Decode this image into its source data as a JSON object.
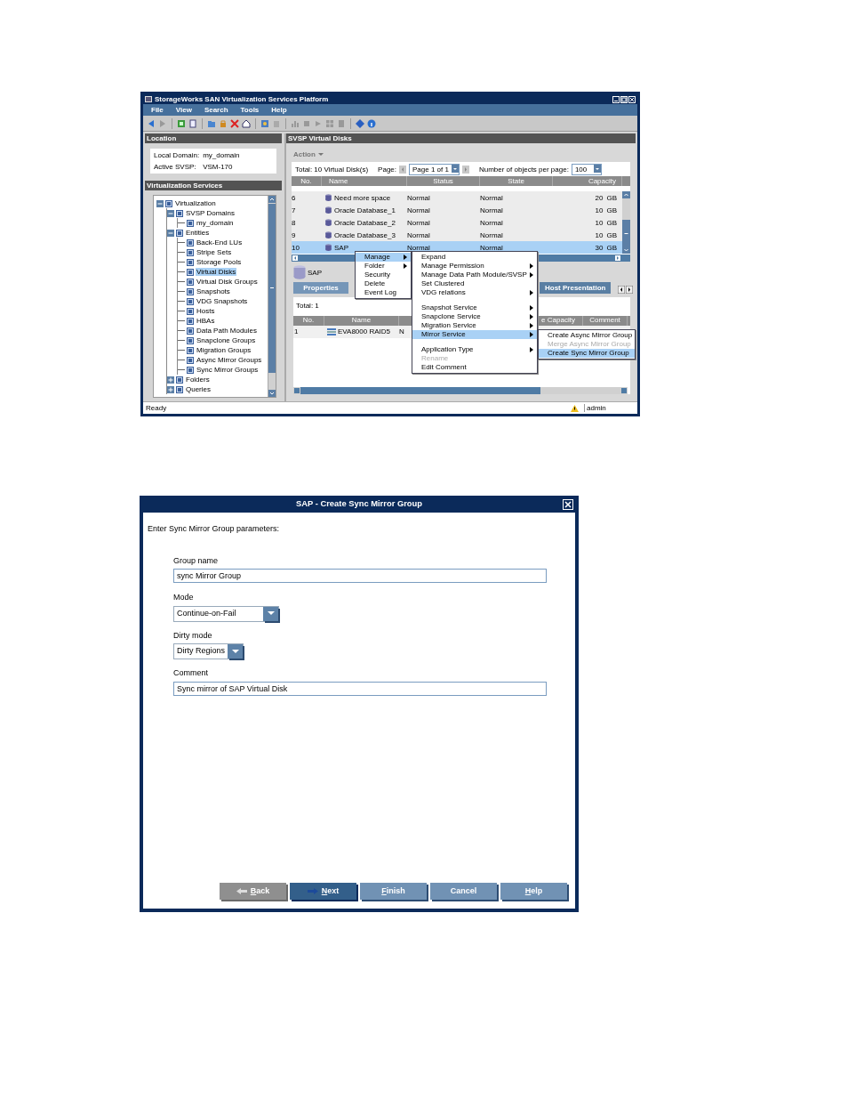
{
  "app": {
    "title": "StorageWorks SAN Virtualization Services Platform",
    "menu": [
      "File",
      "View",
      "Search",
      "Tools",
      "Help"
    ],
    "location": {
      "title": "Location",
      "fields": [
        {
          "label": "Local Domain:",
          "value": "my_domain"
        },
        {
          "label": "Active SVSP:",
          "value": "VSM-170"
        }
      ]
    },
    "tree": {
      "title": "Virtualization Services",
      "items": [
        {
          "label": "Virtualization",
          "expanded": true,
          "selected": false,
          "children": [
            {
              "label": "SVSP Domains",
              "expanded": true,
              "selected": false,
              "children": [
                {
                  "label": "my_domain",
                  "selected": false
                }
              ]
            },
            {
              "label": "Entities",
              "expanded": true,
              "selected": false,
              "children": [
                {
                  "label": "Back-End LUs",
                  "selected": false
                },
                {
                  "label": "Stripe Sets",
                  "selected": false
                },
                {
                  "label": "Storage Pools",
                  "selected": false
                },
                {
                  "label": "Virtual Disks",
                  "selected": true
                },
                {
                  "label": "Virtual Disk Groups",
                  "selected": false
                },
                {
                  "label": "Snapshots",
                  "selected": false
                },
                {
                  "label": "VDG Snapshots",
                  "selected": false
                },
                {
                  "label": "Hosts",
                  "selected": false
                },
                {
                  "label": "HBAs",
                  "selected": false
                },
                {
                  "label": "Data Path Modules",
                  "selected": false
                },
                {
                  "label": "Snapclone Groups",
                  "selected": false
                },
                {
                  "label": "Migration Groups",
                  "selected": false
                },
                {
                  "label": "Async Mirror Groups",
                  "selected": false
                },
                {
                  "label": "Sync Mirror Groups",
                  "selected": false
                }
              ]
            },
            {
              "label": "Folders",
              "expanded": false,
              "selected": false
            },
            {
              "label": "Queries",
              "expanded": false,
              "selected": false
            }
          ]
        }
      ]
    },
    "panel": {
      "title": "SVSP Virtual Disks",
      "action": "Action",
      "total": "Total: 10 Virtual Disk(s)",
      "page_label": "Page:",
      "page": "Page 1 of 1",
      "per_page_label": "Number of objects per page:",
      "per_page": "100",
      "columns": [
        "No.",
        "Name",
        "Status",
        "State",
        "Capacity"
      ],
      "rows": [
        {
          "no": "6",
          "name": "Need more space",
          "status": "Normal",
          "state": "Normal",
          "capacity": "20",
          "unit": "GB",
          "selected": false
        },
        {
          "no": "7",
          "name": "Oracle Database_1",
          "status": "Normal",
          "state": "Normal",
          "capacity": "10",
          "unit": "GB",
          "selected": false
        },
        {
          "no": "8",
          "name": "Oracle Database_2",
          "status": "Normal",
          "state": "Normal",
          "capacity": "10",
          "unit": "GB",
          "selected": false
        },
        {
          "no": "9",
          "name": "Oracle Database_3",
          "status": "Normal",
          "state": "Normal",
          "capacity": "10",
          "unit": "GB",
          "selected": false
        },
        {
          "no": "10",
          "name": "SAP",
          "status": "Normal",
          "state": "Normal",
          "capacity": "30",
          "unit": "GB",
          "selected": true
        }
      ]
    },
    "detail": {
      "name": "SAP",
      "tabs": [
        {
          "label": "Properties",
          "selected": true
        },
        {
          "label": "Host Presentation",
          "selected": false
        }
      ],
      "total": "Total: 1",
      "columns": [
        "No.",
        "Name",
        "e Capacity",
        "Comment"
      ],
      "rows": [
        {
          "no": "1",
          "name": "EVA8000 RAID5",
          "column_3": "N"
        }
      ]
    },
    "context_menu": {
      "items": [
        {
          "label": "Manage",
          "submenu": true,
          "selected": true
        },
        {
          "label": "Folder",
          "submenu": true,
          "selected": false
        },
        {
          "label": "Security",
          "submenu": false,
          "selected": false
        },
        {
          "label": "Delete",
          "submenu": false,
          "selected": false
        },
        {
          "label": "Event Log",
          "submenu": false,
          "selected": false
        }
      ]
    },
    "manage_menu": {
      "items": [
        {
          "label": "Expand",
          "submenu": false,
          "selected": false,
          "disabled": false
        },
        {
          "label": "Manage Permission",
          "submenu": true,
          "selected": false,
          "disabled": false
        },
        {
          "label": "Manage Data Path Module/SVSP",
          "submenu": true,
          "selected": false,
          "disabled": false
        },
        {
          "label": "Set Clustered",
          "submenu": false,
          "selected": false,
          "disabled": false
        },
        {
          "label": "VDG relations",
          "submenu": true,
          "selected": false,
          "disabled": false
        },
        {
          "label": "Snapshot Service",
          "submenu": true,
          "selected": false,
          "disabled": false,
          "separator_before": true
        },
        {
          "label": "Snapclone Service",
          "submenu": true,
          "selected": false,
          "disabled": false
        },
        {
          "label": "Migration Service",
          "submenu": true,
          "selected": false,
          "disabled": false
        },
        {
          "label": "Mirror Service",
          "submenu": true,
          "selected": true,
          "disabled": false
        },
        {
          "label": "Application Type",
          "submenu": true,
          "selected": false,
          "disabled": false,
          "separator_before": true
        },
        {
          "label": "Rename",
          "submenu": false,
          "selected": false,
          "disabled": true
        },
        {
          "label": "Edit Comment",
          "submenu": false,
          "selected": false,
          "disabled": false
        }
      ]
    },
    "mirror_menu": {
      "items": [
        {
          "label": "Create Async Mirror Group",
          "submenu": false,
          "selected": false,
          "disabled": false
        },
        {
          "label": "Merge Async Mirror Group",
          "submenu": false,
          "selected": false,
          "disabled": true
        },
        {
          "label": "Create Sync Mirror Group",
          "submenu": false,
          "selected": true,
          "disabled": false
        }
      ]
    },
    "status": {
      "text": "Ready",
      "user": "admin"
    }
  },
  "dialog": {
    "title": "SAP - Create Sync Mirror Group",
    "instruction": "Enter Sync Mirror Group parameters:",
    "fields": [
      {
        "kind": "text",
        "label": "Group name",
        "value": "sync Mirror Group"
      },
      {
        "kind": "select",
        "label": "Mode",
        "value": "Continue-on-Fail"
      },
      {
        "kind": "select",
        "label": "Dirty mode",
        "value": "Dirty Regions"
      },
      {
        "kind": "text",
        "label": "Comment",
        "value": "Sync mirror of SAP Virtual Disk"
      }
    ],
    "buttons": [
      {
        "label": "Back",
        "kind": "back",
        "disabled": true,
        "default": false,
        "underline_first": true
      },
      {
        "label": "Next",
        "kind": "next",
        "disabled": false,
        "default": true,
        "underline_first": true
      },
      {
        "label": "Finish",
        "kind": "plain",
        "disabled": false,
        "default": false,
        "underline_first": true
      },
      {
        "label": "Cancel",
        "kind": "plain",
        "disabled": false,
        "default": false,
        "underline_first": false
      },
      {
        "label": "Help",
        "kind": "plain",
        "disabled": false,
        "default": false,
        "underline_first": true
      }
    ]
  }
}
